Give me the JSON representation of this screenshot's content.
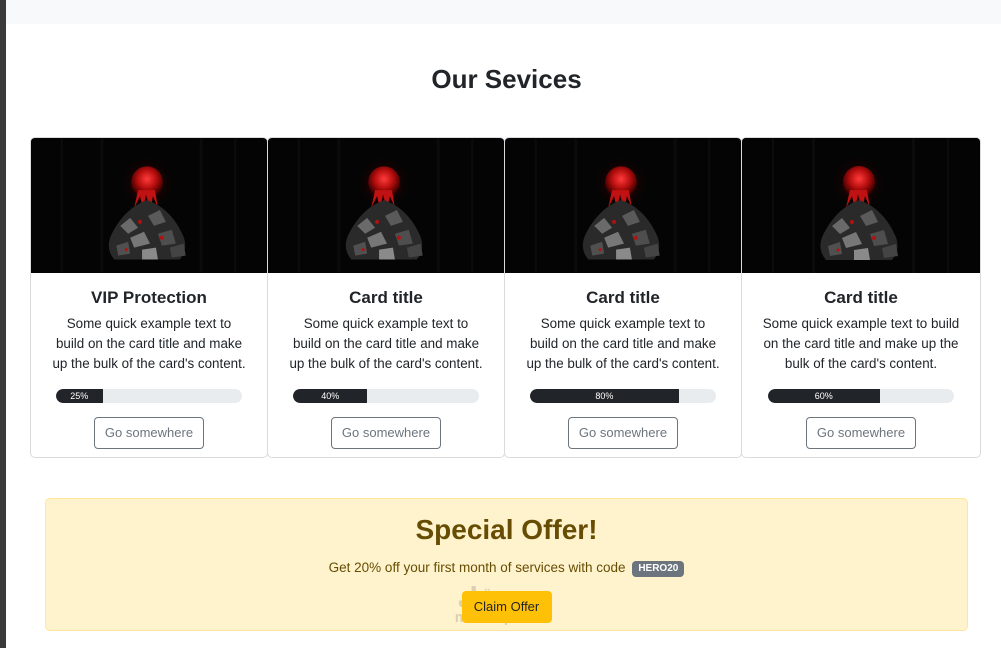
{
  "page": {
    "section_title": "Our Sevices"
  },
  "cards": [
    {
      "title": "VIP Protection",
      "text": "Some quick example text to build on the card title and make up the bulk of the card's content.",
      "progress": 25,
      "progress_label": "25%",
      "button": "Go somewhere"
    },
    {
      "title": "Card title",
      "text": "Some quick example text to build on the card title and make up the bulk of the card's content.",
      "progress": 40,
      "progress_label": "40%",
      "button": "Go somewhere"
    },
    {
      "title": "Card title",
      "text": "Some quick example text to build on the card title and make up the bulk of the card's content.",
      "progress": 80,
      "progress_label": "80%",
      "button": "Go somewhere"
    },
    {
      "title": "Card title",
      "text": "Some quick example text to build on the card title and make up the bulk of the card's content.",
      "progress": 60,
      "progress_label": "60%",
      "button": "Go somewhere"
    }
  ],
  "offer": {
    "title": "Special Offer!",
    "text": "Get 20% off your first month of services with code",
    "code": "HERO20",
    "button": "Claim Offer"
  },
  "watermark": {
    "logo": "مستقل",
    "url": "mostaql.com"
  },
  "colors": {
    "offer_bg": "#fff3cd",
    "offer_text": "#664d03",
    "claim_button": "#ffc107",
    "progress_fill": "#212529",
    "badge": "#6c757d"
  }
}
